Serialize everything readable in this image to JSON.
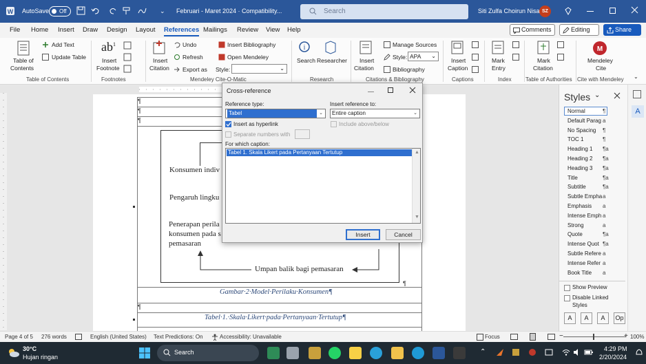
{
  "titlebar": {
    "autosave_label": "AutoSave",
    "autosave_state": "Off",
    "doc_title": "Februari - Maret 2024 · Compatibility...",
    "search_placeholder": "Search",
    "user_name": "Siti Zulfa Choirun Nisa",
    "user_initials": "SZ"
  },
  "menubar": {
    "items": [
      "File",
      "Home",
      "Insert",
      "Draw",
      "Design",
      "Layout",
      "References",
      "Mailings",
      "Review",
      "View",
      "Help"
    ],
    "active": "References",
    "comments_label": "Comments",
    "editing_label": "Editing",
    "share_label": "Share"
  },
  "ribbon": {
    "toc": {
      "label1": "Table of",
      "label2": "Contents",
      "add_text": "Add Text",
      "update_table": "Update Table",
      "group": "Table of Contents"
    },
    "footnotes": {
      "insert_label1": "Insert",
      "insert_label2": "Footnote",
      "group": "Footnotes"
    },
    "mendeley": {
      "insert_label1": "Insert",
      "insert_label2": "Citation",
      "undo": "Undo",
      "refresh": "Refresh",
      "export": "Export as",
      "insert_bib": "Insert Bibliography",
      "open_mendeley": "Open Mendeley",
      "style_label": "Style:",
      "group": "Mendeley Cite-O-Matic"
    },
    "research": {
      "search": "Search",
      "researcher": "Researcher",
      "group": "Research"
    },
    "citations": {
      "insert1": "Insert",
      "insert2": "Citation",
      "manage": "Manage Sources",
      "style_label": "Style:",
      "style_value": "APA",
      "bibliography": "Bibliography",
      "group": "Citations & Bibliography"
    },
    "captions": {
      "insert1": "Insert",
      "insert2": "Caption",
      "group": "Captions"
    },
    "index": {
      "mark1": "Mark",
      "mark2": "Entry",
      "group": "Index"
    },
    "authorities": {
      "mark1": "Mark",
      "mark2": "Citation",
      "group": "Table of Authorities"
    },
    "mendeley_cite": {
      "label1": "Mendeley",
      "label2": "Cite",
      "group": "Cite with Mendeley"
    }
  },
  "document": {
    "pilcrow": "¶",
    "text1": "Konsumen indiv",
    "text2": "Pengaruh lingku",
    "text3a": "Penerapan perila",
    "text3b": "konsumen pada s",
    "text3c": "pemasaran",
    "feedback": "Umpan balik bagi pemasaran",
    "caption1": "Gambar·2·Model·Perilaku·Konsumen¶",
    "caption2": "Tabel·1.·Skala·Likert·pada·Pertanyaan·Tertutup¶"
  },
  "dialog": {
    "title": "Cross-reference",
    "ref_type_label": "Reference type:",
    "ref_type_value": "Tabel",
    "insert_ref_label": "Insert reference to:",
    "insert_ref_value": "Entire caption",
    "hyperlink_label": "Insert as hyperlink",
    "above_below_label": "Include above/below",
    "separate_label": "Separate numbers with",
    "which_caption_label": "For which caption:",
    "captions": [
      "Tabel 1. Skala Likert pada Pertanyaan Tertutup"
    ],
    "insert_button": "Insert",
    "cancel_button": "Cancel"
  },
  "styles_pane": {
    "title": "Styles",
    "items": [
      {
        "name": "Normal",
        "mark": "¶"
      },
      {
        "name": "Default Parag",
        "mark": "a"
      },
      {
        "name": "No Spacing",
        "mark": "¶"
      },
      {
        "name": "TOC 1",
        "mark": "¶"
      },
      {
        "name": "Heading 1",
        "mark": "¶a"
      },
      {
        "name": "Heading 2",
        "mark": "¶a"
      },
      {
        "name": "Heading 3",
        "mark": "¶a"
      },
      {
        "name": "Title",
        "mark": "¶a"
      },
      {
        "name": "Subtitle",
        "mark": "¶a"
      },
      {
        "name": "Subtle Empha",
        "mark": "a"
      },
      {
        "name": "Emphasis",
        "mark": "a"
      },
      {
        "name": "Intense Emph",
        "mark": "a"
      },
      {
        "name": "Strong",
        "mark": "a"
      },
      {
        "name": "Quote",
        "mark": "¶a"
      },
      {
        "name": "Intense Quot",
        "mark": "¶a"
      },
      {
        "name": "Subtle Refere",
        "mark": "a"
      },
      {
        "name": "Intense Refer",
        "mark": "a"
      },
      {
        "name": "Book Title",
        "mark": "a"
      }
    ],
    "show_preview": "Show Preview",
    "disable_linked1": "Disable Linked",
    "disable_linked2": "Styles"
  },
  "statusbar": {
    "page": "Page 4 of 5",
    "words": "276 words",
    "language": "English (United States)",
    "predictions": "Text Predictions: On",
    "accessibility": "Accessibility: Unavailable",
    "focus": "Focus",
    "zoom": "100%"
  },
  "taskbar": {
    "temp": "30°C",
    "weather": "Hujan ringan",
    "search": "Search",
    "time": "4:29 PM",
    "date": "2/20/2024"
  },
  "colors": {
    "titlebar": "#2b579a",
    "accent": "#185abd",
    "avatar": "#c43e1c",
    "selection": "#2f6fcf"
  }
}
